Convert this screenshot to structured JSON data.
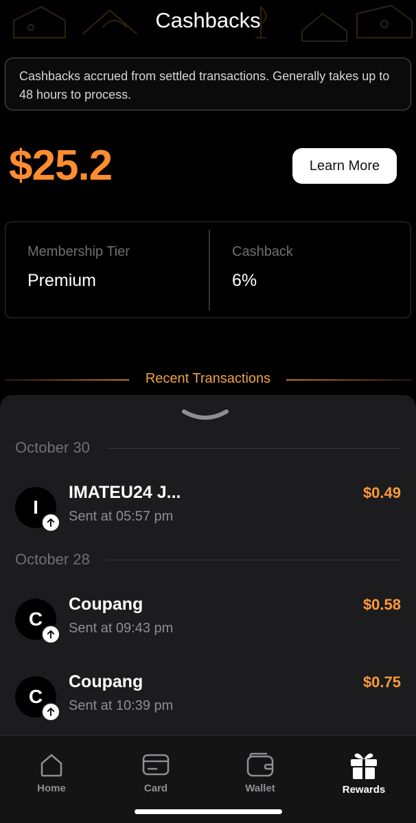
{
  "header": {
    "title": "Cashbacks"
  },
  "info": {
    "text": "Cashbacks accrued from settled transactions. Generally takes up to 48 hours to process."
  },
  "summary": {
    "amount": "$25.2",
    "learn_more_label": "Learn More"
  },
  "tier": {
    "membership_label": "Membership Tier",
    "membership_value": "Premium",
    "cashback_label": "Cashback",
    "cashback_value": "6%"
  },
  "recent": {
    "title": "Recent Transactions"
  },
  "groups": [
    {
      "date": "October 30",
      "transactions": [
        {
          "initial": "I",
          "name": "IMATEU24 J...",
          "time": "Sent at 05:57 pm",
          "amount": "$0.49",
          "direction_icon": "arrow-up-icon"
        }
      ]
    },
    {
      "date": "October 28",
      "transactions": [
        {
          "initial": "C",
          "name": "Coupang",
          "time": "Sent at 09:43 pm",
          "amount": "$0.58",
          "direction_icon": "arrow-up-icon"
        },
        {
          "initial": "C",
          "name": "Coupang",
          "time": "Sent at 10:39 pm",
          "amount": "$0.75",
          "direction_icon": "arrow-up-icon"
        }
      ]
    }
  ],
  "tabbar": {
    "tabs": [
      {
        "label": "Home",
        "icon": "home-icon",
        "active": false
      },
      {
        "label": "Card",
        "icon": "card-icon",
        "active": false
      },
      {
        "label": "Wallet",
        "icon": "wallet-icon",
        "active": false
      },
      {
        "label": "Rewards",
        "icon": "gift-icon",
        "active": true
      }
    ]
  },
  "colors": {
    "accent": "#ff8c2e",
    "background": "#000000",
    "sheet": "#1c1c1e"
  }
}
